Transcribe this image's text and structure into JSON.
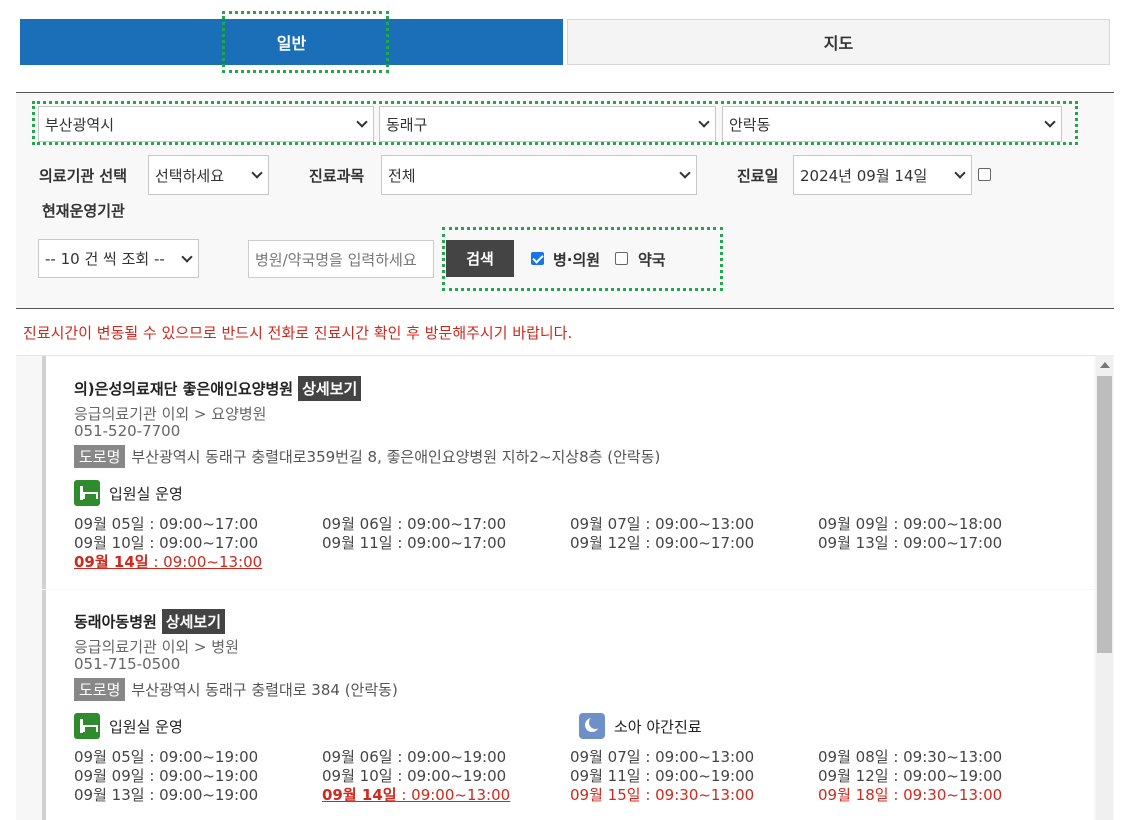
{
  "tabs": {
    "general": "일반",
    "map": "지도"
  },
  "region": {
    "city": "부산광역시",
    "district": "동래구",
    "dong": "안락동"
  },
  "filters": {
    "facility_label": "의료기관 선택",
    "facility_value": "선택하세요",
    "dept_label": "진료과목",
    "dept_value": "전체",
    "date_label": "진료일",
    "date_value": "2024년 09월 14일",
    "operating_label": "현재운영기관",
    "page_size": "-- 10 건 씩 조회 --",
    "search_placeholder": "병원/약국명을 입력하세요",
    "search_button": "검색",
    "hospital_label": "병·의원",
    "pharmacy_label": "약국",
    "hospital_checked": true,
    "pharmacy_checked": false,
    "operating_checked": false
  },
  "notice": "진료시간이 변동될 수 있으므로 반드시 전화로 진료시간 확인 후 방문해주시기 바랍니다.",
  "results": [
    {
      "name": "의)은성의료재단 좋은애인요양병원",
      "detail": "상세보기",
      "category": "응급의료기관 이외 > 요양병원",
      "phone": "051-520-7700",
      "road_label": "도로명",
      "address": "부산광역시 동래구 충렬대로359번길 8, 좋은애인요양병원 지하2~지상8층 (안락동)",
      "feature_1": "입원실 운영",
      "hours": [
        {
          "d": "09월 05일",
          "t": " : 09:00~17:00",
          "s": ""
        },
        {
          "d": "09월 06일",
          "t": " : 09:00~17:00",
          "s": ""
        },
        {
          "d": "09월 07일",
          "t": " : 09:00~13:00",
          "s": ""
        },
        {
          "d": "09월 09일",
          "t": " : 09:00~18:00",
          "s": ""
        },
        {
          "d": "09월 10일",
          "t": " : 09:00~17:00",
          "s": ""
        },
        {
          "d": "09월 11일",
          "t": " : 09:00~17:00",
          "s": ""
        },
        {
          "d": "09월 12일",
          "t": " : 09:00~17:00",
          "s": ""
        },
        {
          "d": "09월 13일",
          "t": " : 09:00~17:00",
          "s": ""
        },
        {
          "d": "09월 14일",
          "t": " : 09:00~13:00",
          "s": "today"
        }
      ]
    },
    {
      "name": "동래아동병원",
      "detail": "상세보기",
      "category": "응급의료기관 이외 > 병원",
      "phone": "051-715-0500",
      "road_label": "도로명",
      "address": "부산광역시 동래구 충렬대로 384 (안락동)",
      "feature_1": "입원실 운영",
      "feature_2": "소아 야간진료",
      "hours": [
        {
          "d": "09월 05일",
          "t": " : 09:00~19:00",
          "s": ""
        },
        {
          "d": "09월 06일",
          "t": " : 09:00~19:00",
          "s": ""
        },
        {
          "d": "09월 07일",
          "t": " : 09:00~13:00",
          "s": ""
        },
        {
          "d": "09월 08일",
          "t": " : 09:30~13:00",
          "s": ""
        },
        {
          "d": "09월 09일",
          "t": " : 09:00~19:00",
          "s": ""
        },
        {
          "d": "09월 10일",
          "t": " : 09:00~19:00",
          "s": ""
        },
        {
          "d": "09월 11일",
          "t": " : 09:00~19:00",
          "s": ""
        },
        {
          "d": "09월 12일",
          "t": " : 09:00~19:00",
          "s": ""
        },
        {
          "d": "09월 13일",
          "t": " : 09:00~19:00",
          "s": ""
        },
        {
          "d": "09월 14일",
          "t": " : 09:00~13:00",
          "s": "today"
        },
        {
          "d": "09월 15일",
          "t": " : 09:30~13:00",
          "s": "red"
        },
        {
          "d": "09월 18일",
          "t": " : 09:30~13:00",
          "s": "red"
        }
      ]
    }
  ]
}
